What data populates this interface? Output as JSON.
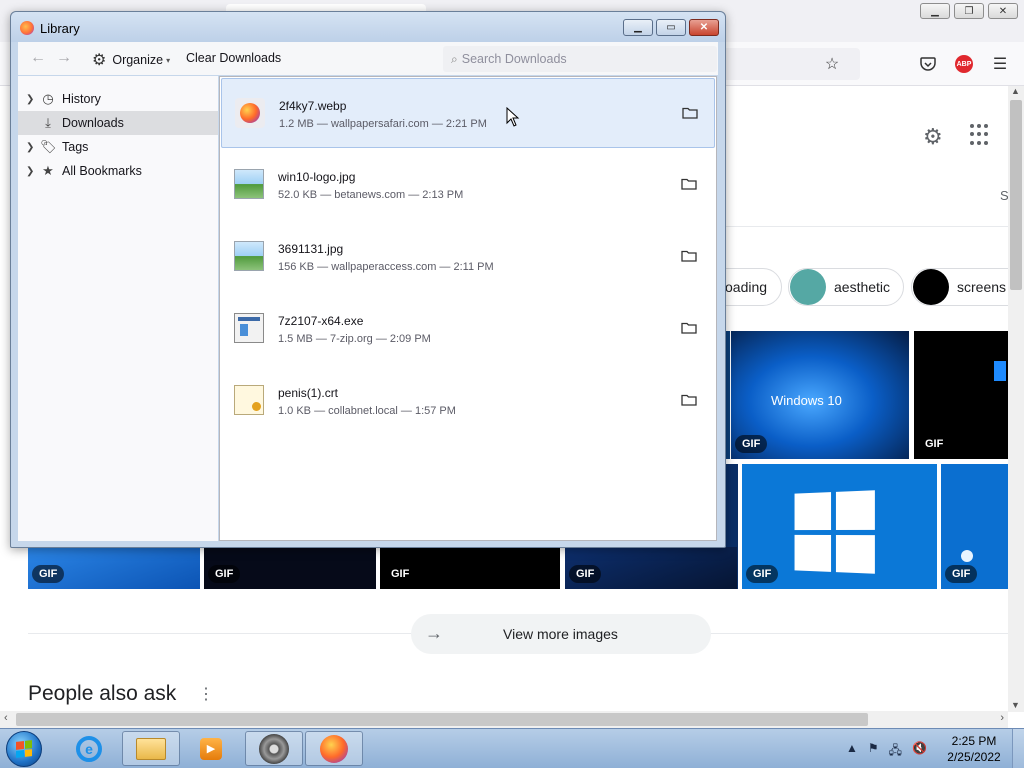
{
  "library": {
    "title": "Library",
    "toolbar": {
      "organize_label": "Organize",
      "clear_label": "Clear Downloads",
      "search_placeholder": "Search Downloads"
    },
    "sidebar": [
      {
        "label": "History",
        "icon": "clock-icon",
        "expandable": true,
        "selected": false
      },
      {
        "label": "Downloads",
        "icon": "download-icon",
        "expandable": false,
        "selected": true
      },
      {
        "label": "Tags",
        "icon": "tags-icon",
        "expandable": true,
        "selected": false
      },
      {
        "label": "All Bookmarks",
        "icon": "star-icon",
        "expandable": true,
        "selected": false
      }
    ],
    "downloads": [
      {
        "name": "2f4ky7.webp",
        "meta": "1.2 MB — wallpapersafari.com — 2:21 PM",
        "type": "webp",
        "selected": true
      },
      {
        "name": "win10-logo.jpg",
        "meta": "52.0 KB — betanews.com — 2:13 PM",
        "type": "image",
        "selected": false
      },
      {
        "name": "3691131.jpg",
        "meta": "156 KB — wallpaperaccess.com — 2:11 PM",
        "type": "image",
        "selected": false
      },
      {
        "name": "7z2107-x64.exe",
        "meta": "1.5 MB — 7-zip.org — 2:09 PM",
        "type": "exe",
        "selected": false
      },
      {
        "name": "penis(1).crt",
        "meta": "1.0 KB — collabnet.local — 1:57 PM",
        "type": "cert",
        "selected": false
      }
    ]
  },
  "browser_page": {
    "chips": {
      "loading": "oading",
      "aesthetic": "aesthetic",
      "screens": "screens"
    },
    "tiles": {
      "gif_badge": "GIF",
      "windows10_caption": "Windows 10"
    },
    "partial_label": "S",
    "view_more": "View more images",
    "people_also_ask": "People also ask"
  },
  "taskbar": {
    "time": "2:25 PM",
    "date": "2/25/2022"
  },
  "colors": {
    "selection_bg": "#e3edfa",
    "selection_border": "#a9c4ea",
    "sidebar_selected": "#dcdde0",
    "library_frame": "#c6d7eb",
    "abp_red": "#e0282e"
  }
}
